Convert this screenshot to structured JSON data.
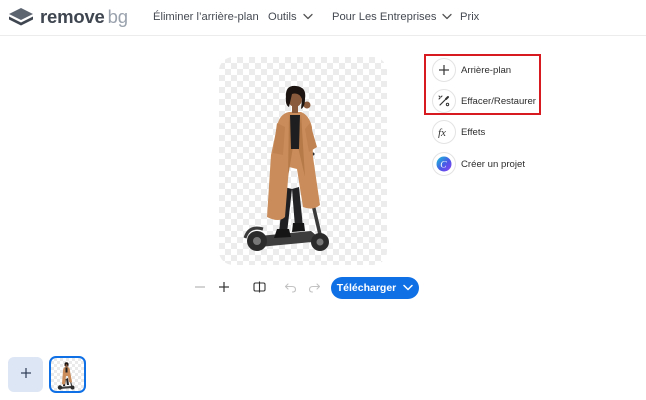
{
  "brand": {
    "word1": "remove",
    "word2": "bg"
  },
  "nav": [
    {
      "label": "Éliminer l’arrière-plan",
      "has_dropdown": false
    },
    {
      "label": "Outils",
      "has_dropdown": true
    },
    {
      "label": "Pour Les Entreprises",
      "has_dropdown": true
    },
    {
      "label": "Prix",
      "has_dropdown": false
    }
  ],
  "tools": [
    {
      "label": "Arrière-plan",
      "icon": "plus-icon",
      "highlighted": true
    },
    {
      "label": "Effacer/Restaurer",
      "icon": "brush-icon",
      "highlighted": true
    },
    {
      "label": "Effets",
      "icon": "fx-icon",
      "highlighted": false
    },
    {
      "label": "Créer un projet",
      "icon": "canva-icon",
      "highlighted": false
    }
  ],
  "toolbar": {
    "zoom_out_icon": "minus-icon",
    "zoom_in_icon": "plus-icon",
    "compare_icon": "compare-icon",
    "undo_icon": "undo-icon",
    "redo_icon": "redo-icon",
    "download_label": "Télécharger"
  },
  "colors": {
    "accent": "#0f70e6",
    "highlight_border": "#d71920",
    "coat": "#c98c5a",
    "add_tile": "#dde6f5"
  }
}
